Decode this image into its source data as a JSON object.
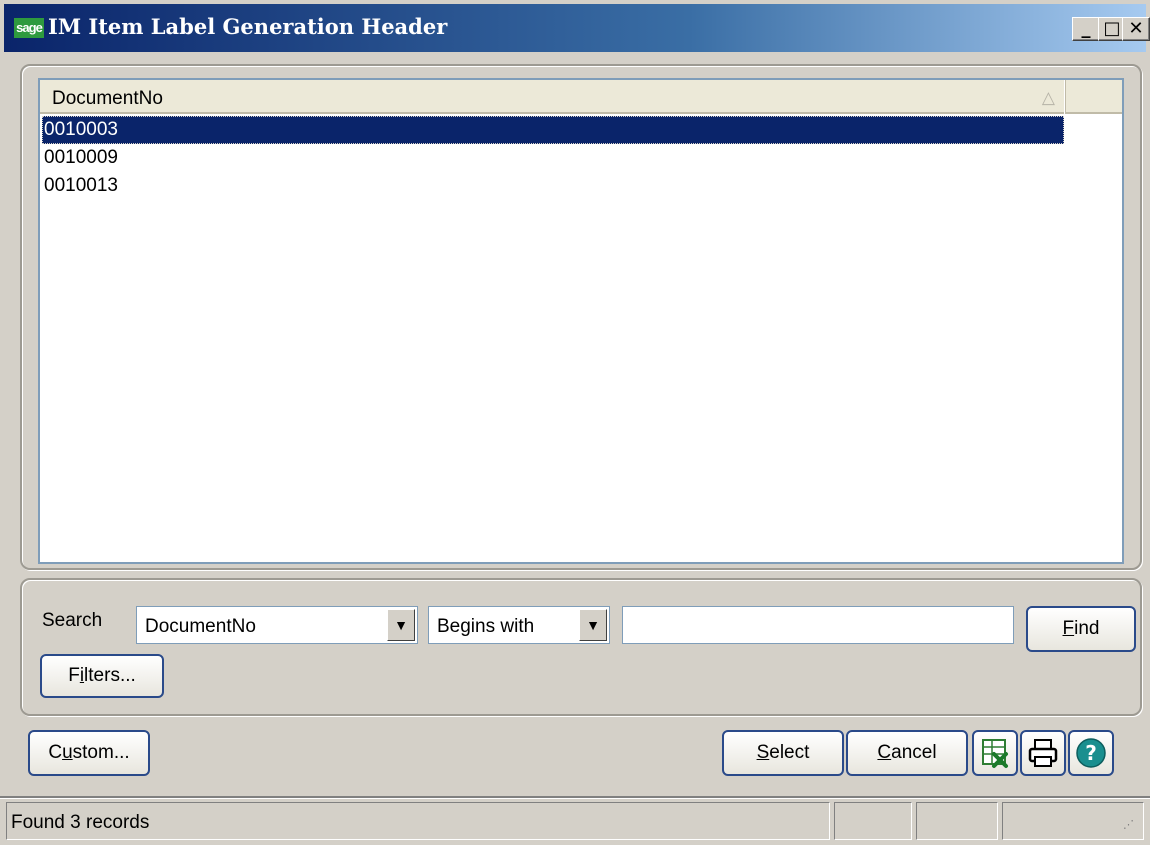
{
  "window": {
    "logo": "sage",
    "title": "IM Item Label Generation Header",
    "minimize": "_",
    "maximize": "□",
    "close": "✕"
  },
  "list": {
    "column_header": "DocumentNo",
    "sort_indicator": "△",
    "rows": [
      "0010003",
      "0010009",
      "0010013"
    ],
    "selected_index": 0
  },
  "search": {
    "label": "Search",
    "field_value": "DocumentNo",
    "operator_value": "Begins with",
    "input_value": "",
    "dropdown_arrow": "▼",
    "find_label": {
      "prefix": "",
      "accel": "F",
      "rest": "ind"
    },
    "filters_label": {
      "prefix": "F",
      "accel": "i",
      "rest": "lters..."
    }
  },
  "buttons": {
    "custom_label": {
      "prefix": "C",
      "accel": "u",
      "rest": "stom..."
    },
    "select_label": {
      "prefix": "",
      "accel": "S",
      "rest": "elect"
    },
    "cancel_label": {
      "prefix": "",
      "accel": "C",
      "rest": "ancel"
    },
    "icons": [
      "excel-export-icon",
      "printer-icon",
      "help-icon"
    ]
  },
  "status": {
    "text": "Found 3 records"
  },
  "colors": {
    "selection": "#0a246a",
    "window_bg": "#d4d0c8",
    "button_border": "#2a4a8a"
  }
}
